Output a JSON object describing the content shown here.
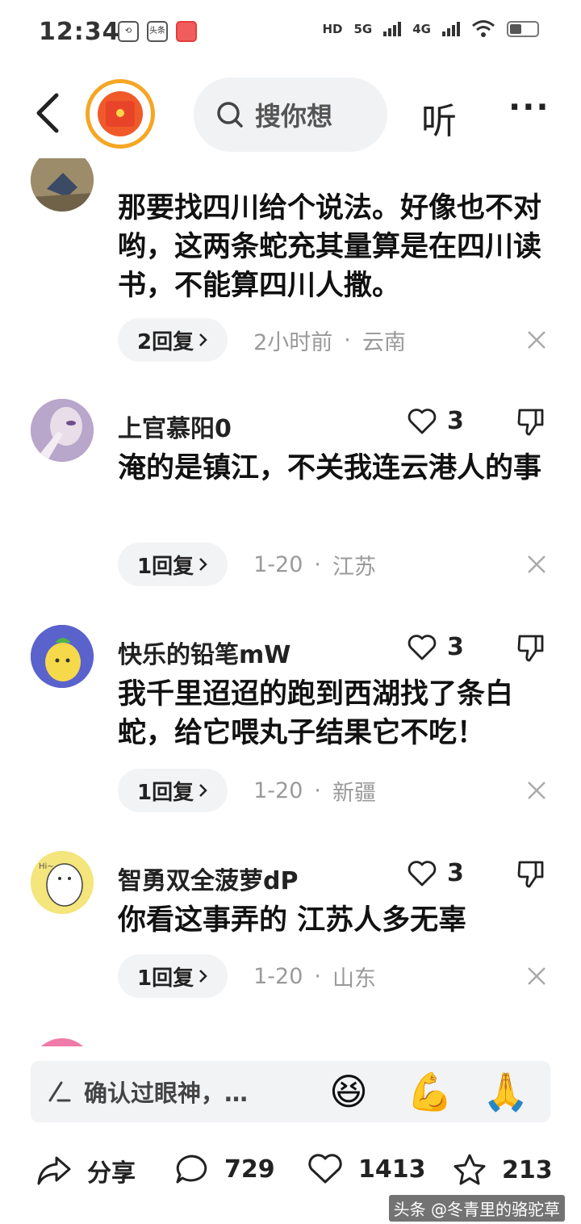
{
  "status_bar": {
    "time": "12:34",
    "app_icons": [
      "rotate-app-icon",
      "toutiao-app-icon",
      "game-app-icon"
    ],
    "app_toutiao_label": "头条",
    "network_hd": "HD",
    "network_5g": "5G",
    "network_4g": "4G"
  },
  "top_bar": {
    "search_placeholder": "搜你想",
    "listen_label": "听",
    "more_label": "···"
  },
  "comments": [
    {
      "username": "",
      "text": "那要找四川给个说法。好像也不对哟，这两条蛇充其量算是在四川读书，不能算四川人撒。",
      "reply_label": "2回复",
      "time": "2小时前",
      "location": "云南",
      "avatar_color": "#8a7b5f"
    },
    {
      "username": "上官慕阳0",
      "like_count": "3",
      "text": "淹的是镇江，不关我连云港人的事",
      "reply_label": "1回复",
      "time": "1-20",
      "location": "江苏",
      "avatar_color": "#c9b8d8"
    },
    {
      "username": "快乐的铅笔mW",
      "like_count": "3",
      "text": "我千里迢迢的跑到西湖找了条白蛇，给它喂丸子结果它不吃！",
      "reply_label": "1回复",
      "time": "1-20",
      "location": "新疆",
      "avatar_color": "#5560c9"
    },
    {
      "username": "智勇双全菠萝dP",
      "like_count": "3",
      "text": "你看这事弄的 江苏人多无辜",
      "reply_label": "1回复",
      "time": "1-20",
      "location": "山东",
      "avatar_color": "#f5e77a"
    }
  ],
  "input_bar": {
    "placeholder": "确认过眼神，…",
    "emojis": [
      "😆",
      "💪",
      "🙏"
    ]
  },
  "bottom_bar": {
    "share_label": "分享",
    "comment_count": "729",
    "like_count": "1413",
    "favorite_count": "213"
  },
  "watermark": "头条 @冬青里的骆驼草",
  "colors": {
    "accent_orange": "#f5a623",
    "meta_gray": "#9a9a9a",
    "pill_bg": "#f2f3f5"
  }
}
